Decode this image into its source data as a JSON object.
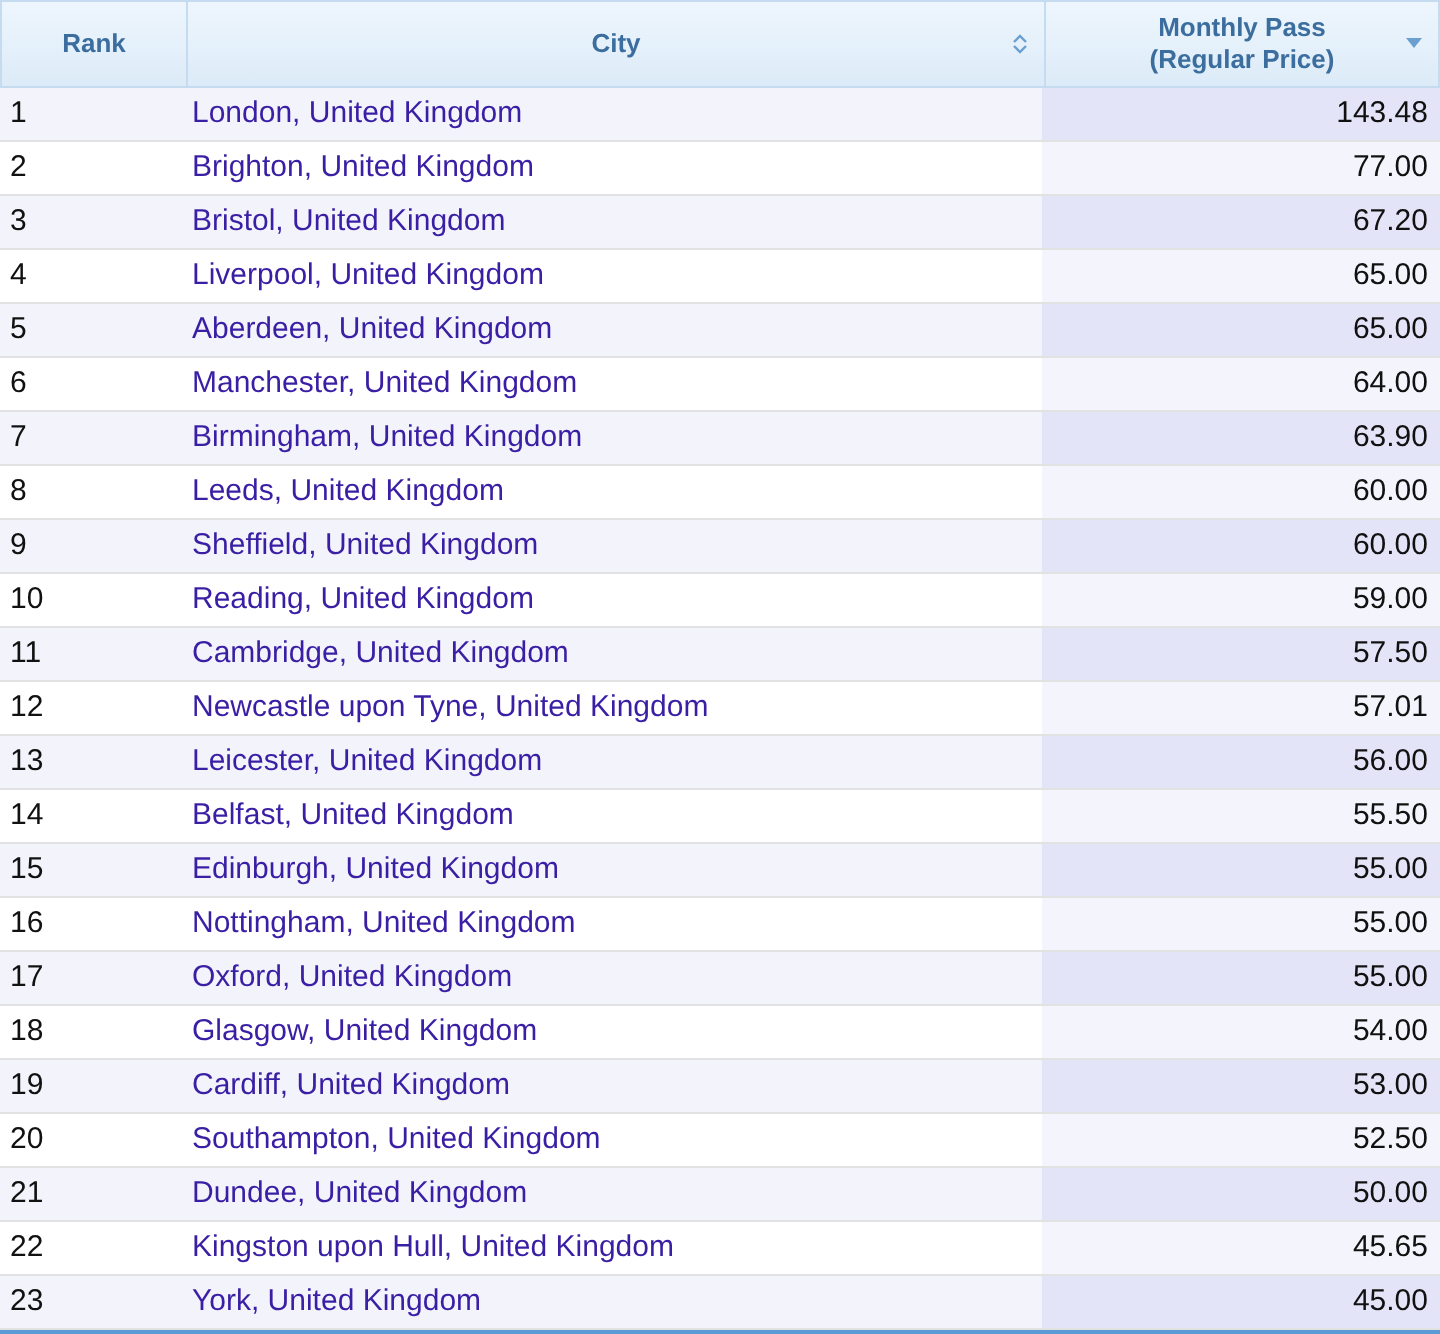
{
  "table": {
    "columns": [
      {
        "label": "Rank"
      },
      {
        "label": "City",
        "sorted": false
      },
      {
        "label": "Monthly Pass (Regular Price)",
        "sorted": true
      }
    ],
    "rows": [
      {
        "rank": "1",
        "city": "London, United Kingdom",
        "price": "143.48"
      },
      {
        "rank": "2",
        "city": "Brighton, United Kingdom",
        "price": "77.00"
      },
      {
        "rank": "3",
        "city": "Bristol, United Kingdom",
        "price": "67.20"
      },
      {
        "rank": "4",
        "city": "Liverpool, United Kingdom",
        "price": "65.00"
      },
      {
        "rank": "5",
        "city": "Aberdeen, United Kingdom",
        "price": "65.00"
      },
      {
        "rank": "6",
        "city": "Manchester, United Kingdom",
        "price": "64.00"
      },
      {
        "rank": "7",
        "city": "Birmingham, United Kingdom",
        "price": "63.90"
      },
      {
        "rank": "8",
        "city": "Leeds, United Kingdom",
        "price": "60.00"
      },
      {
        "rank": "9",
        "city": "Sheffield, United Kingdom",
        "price": "60.00"
      },
      {
        "rank": "10",
        "city": "Reading, United Kingdom",
        "price": "59.00"
      },
      {
        "rank": "11",
        "city": "Cambridge, United Kingdom",
        "price": "57.50"
      },
      {
        "rank": "12",
        "city": "Newcastle upon Tyne, United Kingdom",
        "price": "57.01"
      },
      {
        "rank": "13",
        "city": "Leicester, United Kingdom",
        "price": "56.00"
      },
      {
        "rank": "14",
        "city": "Belfast, United Kingdom",
        "price": "55.50"
      },
      {
        "rank": "15",
        "city": "Edinburgh, United Kingdom",
        "price": "55.00"
      },
      {
        "rank": "16",
        "city": "Nottingham, United Kingdom",
        "price": "55.00"
      },
      {
        "rank": "17",
        "city": "Oxford, United Kingdom",
        "price": "55.00"
      },
      {
        "rank": "18",
        "city": "Glasgow, United Kingdom",
        "price": "54.00"
      },
      {
        "rank": "19",
        "city": "Cardiff, United Kingdom",
        "price": "53.00"
      },
      {
        "rank": "20",
        "city": "Southampton, United Kingdom",
        "price": "52.50"
      },
      {
        "rank": "21",
        "city": "Dundee, United Kingdom",
        "price": "50.00"
      },
      {
        "rank": "22",
        "city": "Kingston upon Hull, United Kingdom",
        "price": "45.65"
      },
      {
        "rank": "23",
        "city": "York, United Kingdom",
        "price": "45.00"
      }
    ]
  }
}
